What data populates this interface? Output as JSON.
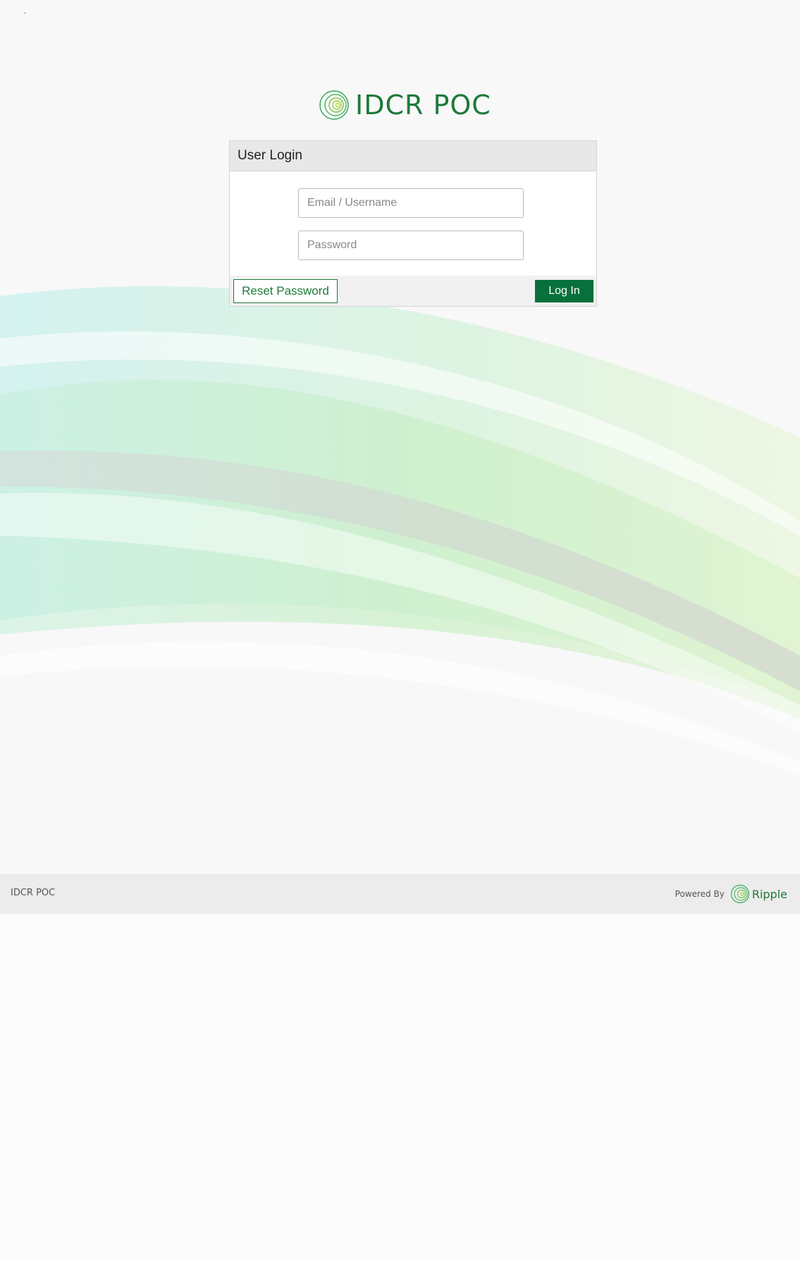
{
  "page": {
    "dot": "."
  },
  "brand": {
    "logo_text": "IDCR POC",
    "logo_icon": "spiral-logo-icon",
    "accent_color": "#1d7a3a",
    "button_color": "#07703b"
  },
  "login": {
    "header": "User Login",
    "email_placeholder": "Email / Username",
    "email_value": "",
    "password_placeholder": "Password",
    "password_value": "",
    "reset_label": "Reset Password",
    "login_label": "Log In"
  },
  "footer": {
    "app_name": "IDCR POC",
    "powered_by": "Powered By",
    "powered_logo_text": "Ripple",
    "powered_logo_icon": "ripple-logo-icon"
  }
}
